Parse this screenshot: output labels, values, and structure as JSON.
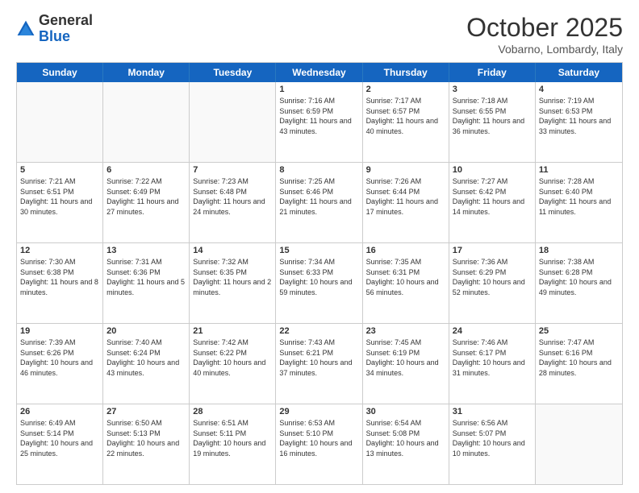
{
  "header": {
    "logo_general": "General",
    "logo_blue": "Blue",
    "month_title": "October 2025",
    "subtitle": "Vobarno, Lombardy, Italy"
  },
  "weekdays": [
    "Sunday",
    "Monday",
    "Tuesday",
    "Wednesday",
    "Thursday",
    "Friday",
    "Saturday"
  ],
  "rows": [
    [
      {
        "day": "",
        "empty": true,
        "text": ""
      },
      {
        "day": "",
        "empty": true,
        "text": ""
      },
      {
        "day": "",
        "empty": true,
        "text": ""
      },
      {
        "day": "1",
        "text": "Sunrise: 7:16 AM\nSunset: 6:59 PM\nDaylight: 11 hours and 43 minutes."
      },
      {
        "day": "2",
        "text": "Sunrise: 7:17 AM\nSunset: 6:57 PM\nDaylight: 11 hours and 40 minutes."
      },
      {
        "day": "3",
        "text": "Sunrise: 7:18 AM\nSunset: 6:55 PM\nDaylight: 11 hours and 36 minutes."
      },
      {
        "day": "4",
        "text": "Sunrise: 7:19 AM\nSunset: 6:53 PM\nDaylight: 11 hours and 33 minutes."
      }
    ],
    [
      {
        "day": "5",
        "text": "Sunrise: 7:21 AM\nSunset: 6:51 PM\nDaylight: 11 hours and 30 minutes."
      },
      {
        "day": "6",
        "text": "Sunrise: 7:22 AM\nSunset: 6:49 PM\nDaylight: 11 hours and 27 minutes."
      },
      {
        "day": "7",
        "text": "Sunrise: 7:23 AM\nSunset: 6:48 PM\nDaylight: 11 hours and 24 minutes."
      },
      {
        "day": "8",
        "text": "Sunrise: 7:25 AM\nSunset: 6:46 PM\nDaylight: 11 hours and 21 minutes."
      },
      {
        "day": "9",
        "text": "Sunrise: 7:26 AM\nSunset: 6:44 PM\nDaylight: 11 hours and 17 minutes."
      },
      {
        "day": "10",
        "text": "Sunrise: 7:27 AM\nSunset: 6:42 PM\nDaylight: 11 hours and 14 minutes."
      },
      {
        "day": "11",
        "text": "Sunrise: 7:28 AM\nSunset: 6:40 PM\nDaylight: 11 hours and 11 minutes."
      }
    ],
    [
      {
        "day": "12",
        "text": "Sunrise: 7:30 AM\nSunset: 6:38 PM\nDaylight: 11 hours and 8 minutes."
      },
      {
        "day": "13",
        "text": "Sunrise: 7:31 AM\nSunset: 6:36 PM\nDaylight: 11 hours and 5 minutes."
      },
      {
        "day": "14",
        "text": "Sunrise: 7:32 AM\nSunset: 6:35 PM\nDaylight: 11 hours and 2 minutes."
      },
      {
        "day": "15",
        "text": "Sunrise: 7:34 AM\nSunset: 6:33 PM\nDaylight: 10 hours and 59 minutes."
      },
      {
        "day": "16",
        "text": "Sunrise: 7:35 AM\nSunset: 6:31 PM\nDaylight: 10 hours and 56 minutes."
      },
      {
        "day": "17",
        "text": "Sunrise: 7:36 AM\nSunset: 6:29 PM\nDaylight: 10 hours and 52 minutes."
      },
      {
        "day": "18",
        "text": "Sunrise: 7:38 AM\nSunset: 6:28 PM\nDaylight: 10 hours and 49 minutes."
      }
    ],
    [
      {
        "day": "19",
        "text": "Sunrise: 7:39 AM\nSunset: 6:26 PM\nDaylight: 10 hours and 46 minutes."
      },
      {
        "day": "20",
        "text": "Sunrise: 7:40 AM\nSunset: 6:24 PM\nDaylight: 10 hours and 43 minutes."
      },
      {
        "day": "21",
        "text": "Sunrise: 7:42 AM\nSunset: 6:22 PM\nDaylight: 10 hours and 40 minutes."
      },
      {
        "day": "22",
        "text": "Sunrise: 7:43 AM\nSunset: 6:21 PM\nDaylight: 10 hours and 37 minutes."
      },
      {
        "day": "23",
        "text": "Sunrise: 7:45 AM\nSunset: 6:19 PM\nDaylight: 10 hours and 34 minutes."
      },
      {
        "day": "24",
        "text": "Sunrise: 7:46 AM\nSunset: 6:17 PM\nDaylight: 10 hours and 31 minutes."
      },
      {
        "day": "25",
        "text": "Sunrise: 7:47 AM\nSunset: 6:16 PM\nDaylight: 10 hours and 28 minutes."
      }
    ],
    [
      {
        "day": "26",
        "text": "Sunrise: 6:49 AM\nSunset: 5:14 PM\nDaylight: 10 hours and 25 minutes."
      },
      {
        "day": "27",
        "text": "Sunrise: 6:50 AM\nSunset: 5:13 PM\nDaylight: 10 hours and 22 minutes."
      },
      {
        "day": "28",
        "text": "Sunrise: 6:51 AM\nSunset: 5:11 PM\nDaylight: 10 hours and 19 minutes."
      },
      {
        "day": "29",
        "text": "Sunrise: 6:53 AM\nSunset: 5:10 PM\nDaylight: 10 hours and 16 minutes."
      },
      {
        "day": "30",
        "text": "Sunrise: 6:54 AM\nSunset: 5:08 PM\nDaylight: 10 hours and 13 minutes."
      },
      {
        "day": "31",
        "text": "Sunrise: 6:56 AM\nSunset: 5:07 PM\nDaylight: 10 hours and 10 minutes."
      },
      {
        "day": "",
        "empty": true,
        "text": ""
      }
    ]
  ]
}
